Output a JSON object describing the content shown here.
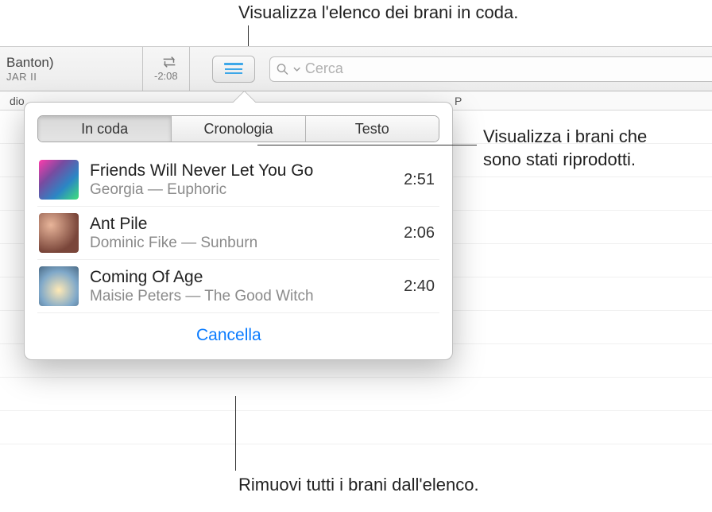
{
  "callouts": {
    "top": "Visualizza l'elenco dei brani in coda.",
    "right_line1": "Visualizza i brani che",
    "right_line2": "sono stati riprodotti.",
    "bottom": "Rimuovi tutti i brani dall'elenco."
  },
  "toolbar": {
    "now_playing_line1": "Banton)",
    "now_playing_line2": "JAR II",
    "time_remaining": "-2:08",
    "search_placeholder": "Cerca"
  },
  "bg_columns": {
    "col1": "dio",
    "col2": "P"
  },
  "popover": {
    "tabs": {
      "queue": "In coda",
      "history": "Cronologia",
      "lyrics": "Testo"
    },
    "tracks": [
      {
        "title": "Friends Will Never Let You Go",
        "subtitle": "Georgia — Euphoric",
        "duration": "2:51"
      },
      {
        "title": "Ant Pile",
        "subtitle": "Dominic Fike — Sunburn",
        "duration": "2:06"
      },
      {
        "title": "Coming Of Age",
        "subtitle": "Maisie Peters — The Good Witch",
        "duration": "2:40"
      }
    ],
    "clear_label": "Cancella"
  }
}
